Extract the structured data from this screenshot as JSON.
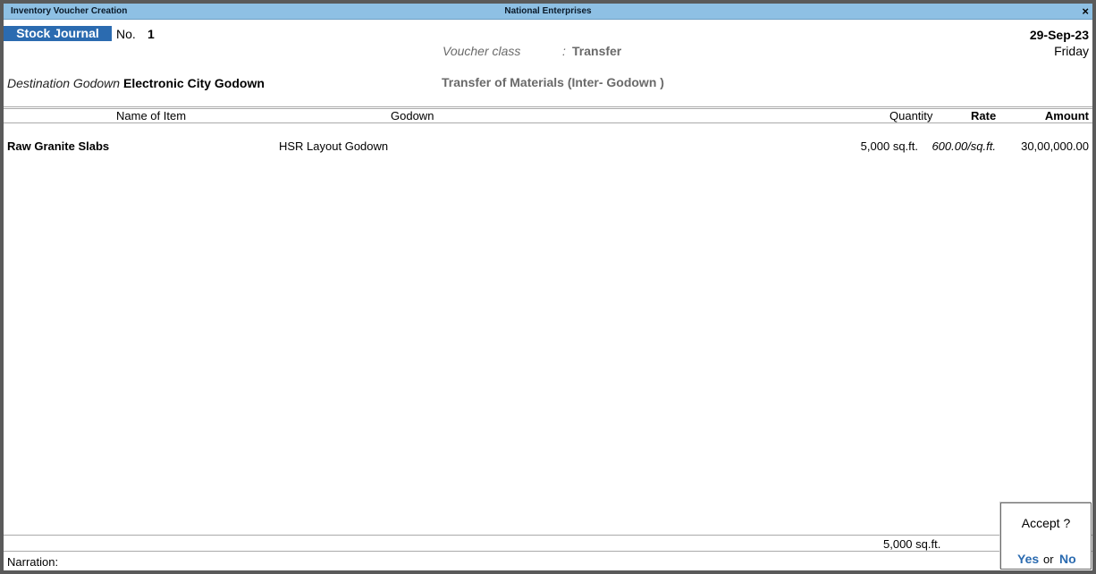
{
  "window": {
    "title_left": "Inventory Voucher Creation",
    "title_center": "National Enterprises",
    "close_glyph": "×"
  },
  "voucher": {
    "type": "Stock Journal",
    "no_label": "No.",
    "no_value": "1",
    "date": "29-Sep-23",
    "day": "Friday",
    "class_label": "Voucher class",
    "class_colon": ":",
    "class_value": "Transfer",
    "dest_label": "Destination Godown :",
    "dest_value": "Electronic City Godown",
    "transfer_desc": "Transfer of Materials (Inter- Godown )"
  },
  "table": {
    "headers": {
      "name": "Name of Item",
      "godown": "Godown",
      "quantity": "Quantity",
      "rate": "Rate",
      "amount": "Amount"
    },
    "rows": [
      {
        "name": "Raw Granite Slabs",
        "godown": "HSR Layout Godown",
        "quantity": "5,000 sq.ft.",
        "rate": "600.00/sq.ft.",
        "amount": "30,00,000.00"
      }
    ],
    "total_quantity": "5,000 sq.ft."
  },
  "footer": {
    "narration_label": "Narration:"
  },
  "accept_dialog": {
    "question": "Accept ?",
    "yes": "Yes",
    "or": "or",
    "no": "No"
  },
  "colors": {
    "titlebar": "#8ec0e4",
    "accent": "#2b6bb0",
    "muted_text": "#6a6a6a"
  }
}
